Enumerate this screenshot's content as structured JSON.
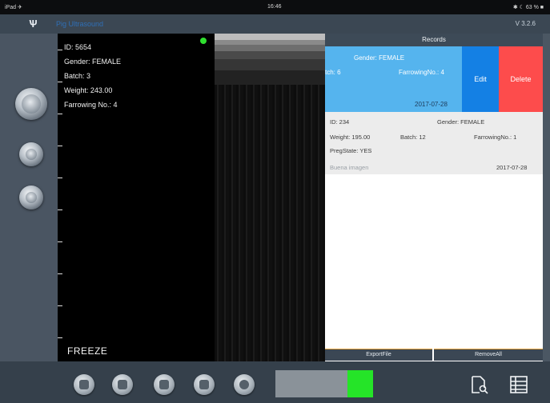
{
  "statusbar": {
    "left": "iPad ✈",
    "time": "16:46",
    "right": "✱ ☾ 63 % ■"
  },
  "titlebar": {
    "logo": "Ѱ",
    "app_title": "Pig Ultrasound",
    "version": "V 3.2.6"
  },
  "viewer": {
    "info": {
      "id": "ID: 5654",
      "gender": "Gender: FEMALE",
      "batch": "Batch: 3",
      "weight": "Weight: 243.00",
      "farrowing": "Farrowing No.: 4"
    },
    "freeze_label": "FREEZE"
  },
  "records": {
    "header": "Records",
    "selected": {
      "gender": "Gender: FEMALE",
      "batch": "tch: 6",
      "farrowing": "FarrowingNo.: 4",
      "date": "2017-07-28",
      "edit_label": "Edit",
      "delete_label": "Delete"
    },
    "item": {
      "id": "ID: 234",
      "gender": "Gender: FEMALE",
      "weight": "Weight: 195.00",
      "batch": "Batch: 12",
      "farrowing": "FarrowingNo.: 1",
      "pregstate": "PregState: YES",
      "note": "Buena imagen",
      "date": "2017-07-28"
    },
    "export_label": "ExportFile",
    "remove_label": "RemoveAll"
  },
  "bottombar": {
    "buttons": [
      "photo-icon",
      "video-icon",
      "save-icon",
      "ppt-icon",
      "settings-icon"
    ],
    "gauge_fill_color": "#25e428"
  }
}
